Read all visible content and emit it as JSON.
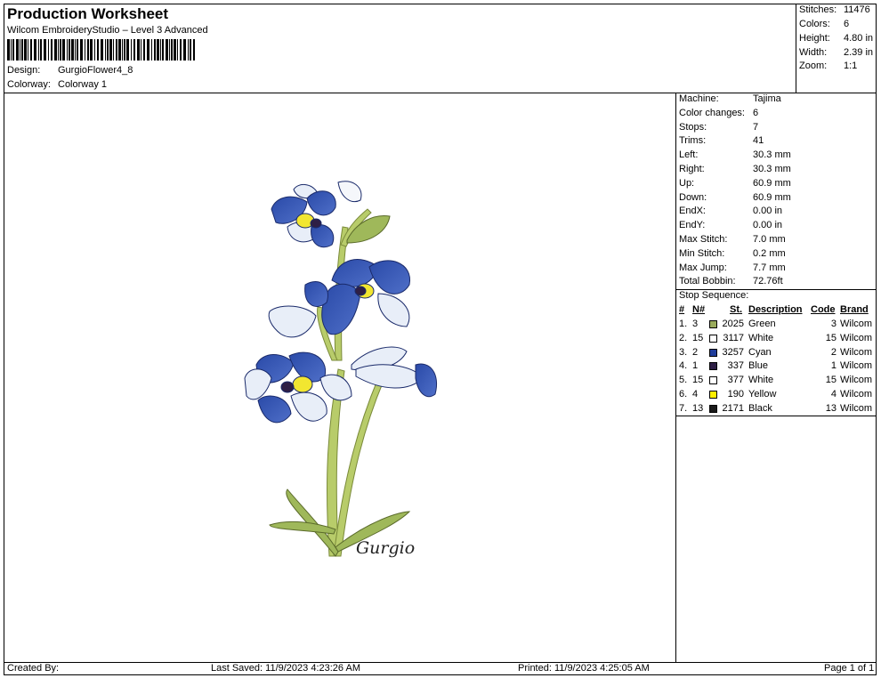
{
  "header": {
    "title": "Production Worksheet",
    "subtitle": "Wilcom EmbroideryStudio – Level 3 Advanced",
    "design_label": "Design:",
    "design_value": "GurgioFlower4_8",
    "colorway_label": "Colorway:",
    "colorway_value": "Colorway 1"
  },
  "summary": [
    {
      "label": "Stitches:",
      "value": "11476"
    },
    {
      "label": "Colors:",
      "value": "6"
    },
    {
      "label": "Height:",
      "value": "4.80 in"
    },
    {
      "label": "Width:",
      "value": "2.39 in"
    },
    {
      "label": "Zoom:",
      "value": "1:1"
    }
  ],
  "machine_info": [
    {
      "label": "Machine:",
      "value": "Tajima"
    },
    {
      "label": "Color changes:",
      "value": "6"
    },
    {
      "label": "Stops:",
      "value": "7"
    },
    {
      "label": "Trims:",
      "value": "41"
    },
    {
      "label": "Left:",
      "value": "30.3 mm"
    },
    {
      "label": "Right:",
      "value": "30.3 mm"
    },
    {
      "label": "Up:",
      "value": "60.9 mm"
    },
    {
      "label": "Down:",
      "value": "60.9 mm"
    },
    {
      "label": "EndX:",
      "value": "0.00 in"
    },
    {
      "label": "EndY:",
      "value": "0.00 in"
    },
    {
      "label": "Max Stitch:",
      "value": "7.0 mm"
    },
    {
      "label": "Min Stitch:",
      "value": "0.2 mm"
    },
    {
      "label": "Max Jump:",
      "value": "7.7 mm"
    },
    {
      "label": "Total Bobbin:",
      "value": "72.76ft"
    }
  ],
  "stop_sequence": {
    "title": "Stop Sequence:",
    "headers": {
      "num": "#",
      "n": "N#",
      "st": "St.",
      "desc": "Description",
      "code": "Code",
      "brand": "Brand"
    },
    "rows": [
      {
        "num": "1.",
        "n": "3",
        "color": "#9aab5c",
        "st": "2025",
        "desc": "Green",
        "code": "3",
        "brand": "Wilcom"
      },
      {
        "num": "2.",
        "n": "15",
        "color": "#ffffff",
        "st": "3117",
        "desc": "White",
        "code": "15",
        "brand": "Wilcom"
      },
      {
        "num": "3.",
        "n": "2",
        "color": "#1f3c9a",
        "st": "3257",
        "desc": "Cyan",
        "code": "2",
        "brand": "Wilcom"
      },
      {
        "num": "4.",
        "n": "1",
        "color": "#2e1f45",
        "st": "337",
        "desc": "Blue",
        "code": "1",
        "brand": "Wilcom"
      },
      {
        "num": "5.",
        "n": "15",
        "color": "#ffffff",
        "st": "377",
        "desc": "White",
        "code": "15",
        "brand": "Wilcom"
      },
      {
        "num": "6.",
        "n": "4",
        "color": "#ffee00",
        "st": "190",
        "desc": "Yellow",
        "code": "4",
        "brand": "Wilcom"
      },
      {
        "num": "7.",
        "n": "13",
        "color": "#1a1a1a",
        "st": "2171",
        "desc": "Black",
        "code": "13",
        "brand": "Wilcom"
      }
    ]
  },
  "design": {
    "signature": "Gurgio"
  },
  "footer": {
    "created_by": "Created By:",
    "last_saved": "Last Saved: 11/9/2023 4:23:26 AM",
    "printed": "Printed: 11/9/2023 4:25:05 AM",
    "page": "Page 1 of 1"
  }
}
